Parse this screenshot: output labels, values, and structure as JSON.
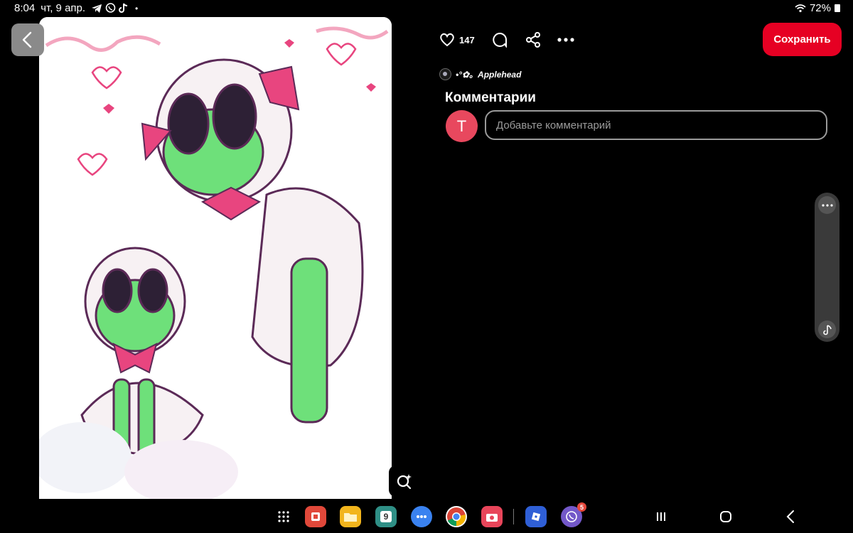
{
  "status_bar": {
    "time": "8:04",
    "date": "чт, 9 апр.",
    "notification_icons": [
      "telegram-icon",
      "viber-icon",
      "tiktok-icon"
    ],
    "more_dot": "•",
    "wifi_icon": "wifi-icon",
    "battery": "72%"
  },
  "pin": {
    "like_count": "147",
    "save_label": "Сохранить",
    "author_name": "•°✿。Applehead",
    "comments_title": "Комментарии",
    "user_initial": "T",
    "comment_placeholder": "Добавьте комментарий"
  },
  "dock": {
    "apps": [
      {
        "name": "app-red",
        "color": "#e1483a"
      },
      {
        "name": "files",
        "color": "#f2b51c"
      },
      {
        "name": "calendar",
        "color": "#2f8f86",
        "label": "9"
      },
      {
        "name": "messages",
        "color": "#3a82f0"
      },
      {
        "name": "chrome",
        "color": "#ffffff"
      },
      {
        "name": "camera",
        "color": "#e8455a"
      },
      {
        "name": "roblox",
        "color": "#2f5fd6"
      },
      {
        "name": "viber",
        "color": "#7358c9",
        "badge": "5"
      }
    ]
  },
  "colors": {
    "accent": "#e60023",
    "avatar": "#e8485e",
    "background": "#000000"
  }
}
